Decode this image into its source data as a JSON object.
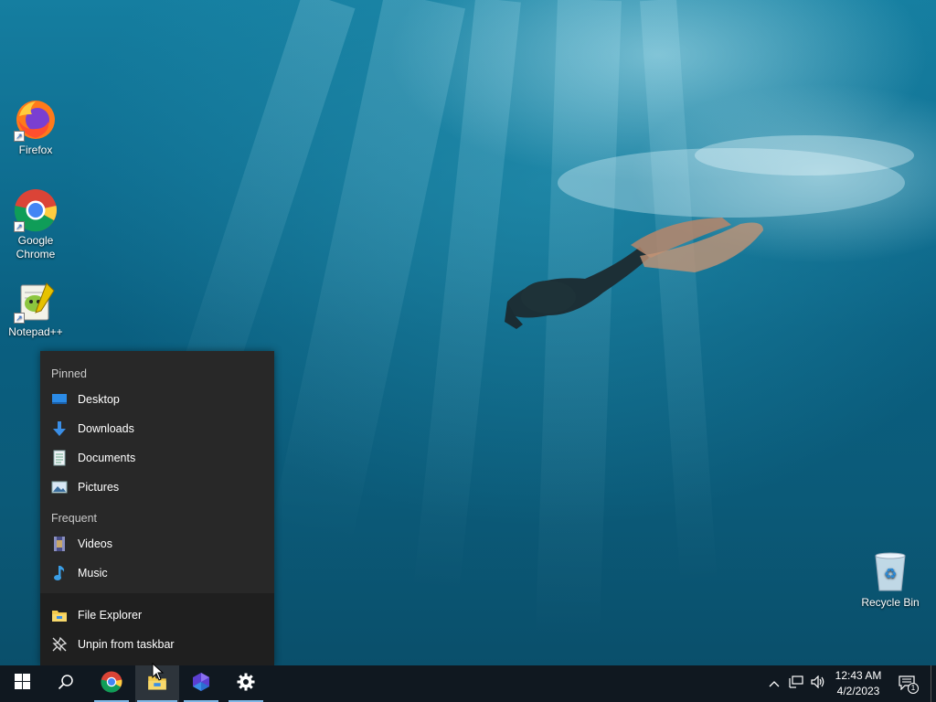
{
  "desktop": {
    "icons": [
      {
        "label": "Firefox",
        "icon": "firefox-icon"
      },
      {
        "label": "Google Chrome",
        "icon": "chrome-icon"
      },
      {
        "label": "Notepad++",
        "icon": "notepadpp-icon"
      },
      {
        "label": "Recycle Bin",
        "icon": "recycle-bin-icon"
      }
    ]
  },
  "jumplist": {
    "pinned_header": "Pinned",
    "pinned": [
      {
        "label": "Desktop",
        "icon": "desktop-folder-icon"
      },
      {
        "label": "Downloads",
        "icon": "downloads-folder-icon"
      },
      {
        "label": "Documents",
        "icon": "documents-folder-icon"
      },
      {
        "label": "Pictures",
        "icon": "pictures-folder-icon"
      }
    ],
    "frequent_header": "Frequent",
    "frequent": [
      {
        "label": "Videos",
        "icon": "videos-folder-icon"
      },
      {
        "label": "Music",
        "icon": "music-folder-icon"
      }
    ],
    "actions": [
      {
        "label": "File Explorer",
        "icon": "file-explorer-icon"
      },
      {
        "label": "Unpin from taskbar",
        "icon": "unpin-icon"
      }
    ]
  },
  "taskbar": {
    "apps": [
      {
        "name": "Start",
        "icon": "windows-start-icon"
      },
      {
        "name": "Search",
        "icon": "search-icon"
      },
      {
        "name": "Google Chrome",
        "icon": "chrome-icon"
      },
      {
        "name": "File Explorer",
        "icon": "file-explorer-icon"
      },
      {
        "name": "Power Automate",
        "icon": "power-automate-icon"
      },
      {
        "name": "Settings",
        "icon": "gear-icon"
      }
    ],
    "clock": {
      "time": "12:43 AM",
      "date": "4/2/2023"
    },
    "notification_count": "1"
  },
  "colors": {
    "taskbar_bg": "#101820",
    "jumplist_bg": "#2b2b2b",
    "accent_underline": "#7fb7e6"
  }
}
